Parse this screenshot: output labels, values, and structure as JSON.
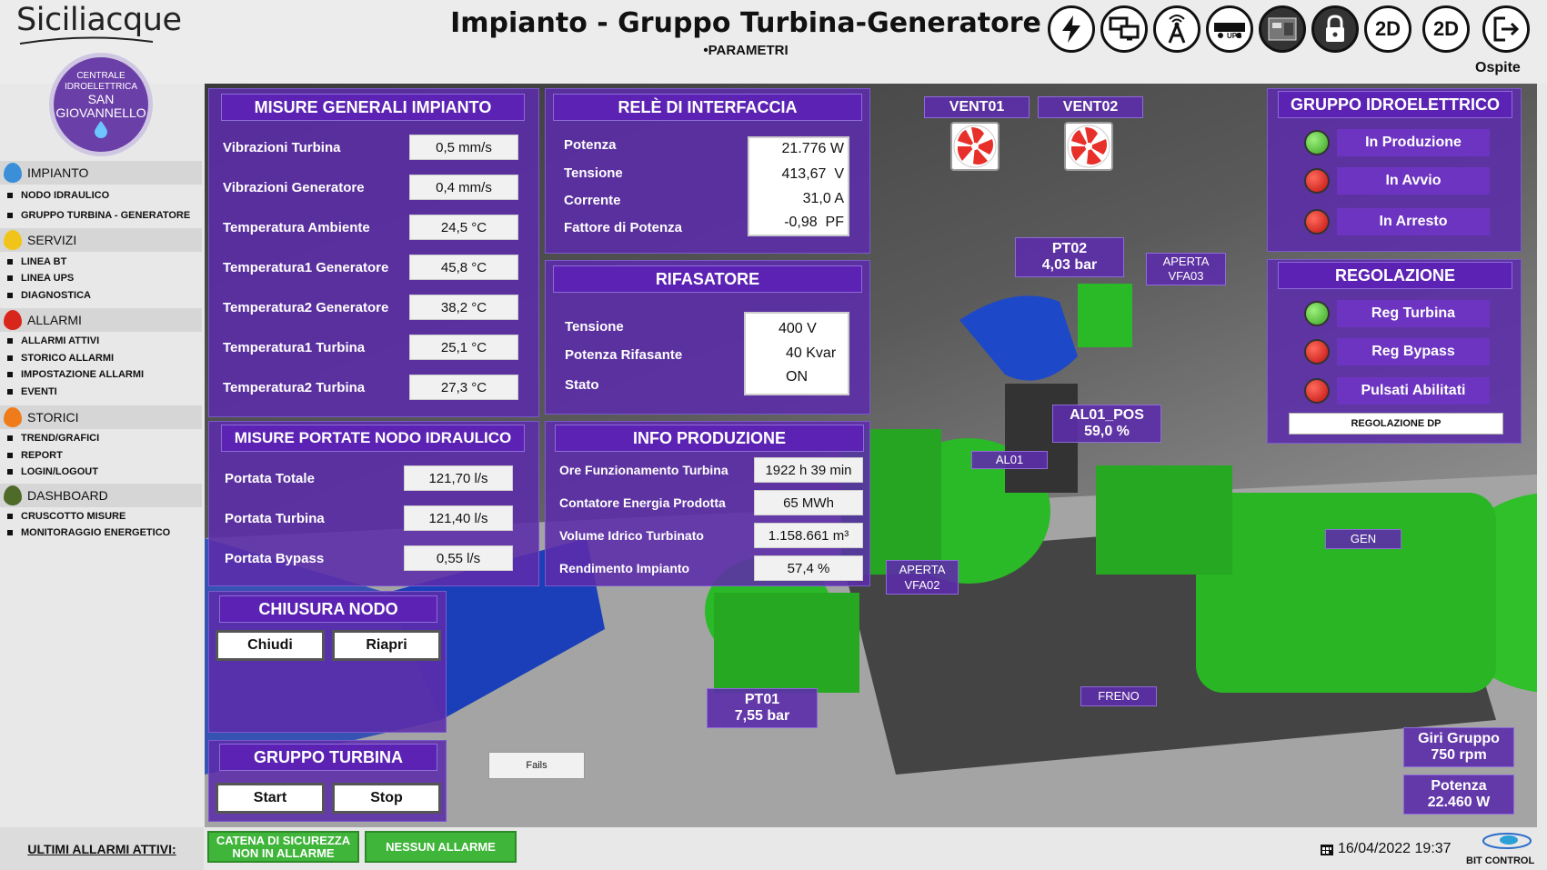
{
  "brand": "Siciliacque",
  "header": {
    "title": "Impianto - Gruppo Turbina-Generatore",
    "subtitle": "•PARAMETRI",
    "user": "Ospite"
  },
  "toolbar": {
    "btn_2d_a": "2D",
    "btn_2d_b": "2D",
    "ups_label": "UPS"
  },
  "logo": {
    "line1": "CENTRALE",
    "line2": "IDROELETTRICA",
    "line3": "SAN",
    "line4": "GIOVANNELLO"
  },
  "sidebar": {
    "impianto": {
      "label": "IMPIANTO",
      "items": [
        "NODO IDRAULICO",
        "GRUPPO TURBINA - GENERATORE"
      ],
      "color": "#3a8fd8"
    },
    "servizi": {
      "label": "SERVIZI",
      "items": [
        "LINEA BT",
        "LINEA UPS",
        "DIAGNOSTICA"
      ],
      "color": "#f0c419"
    },
    "allarmi": {
      "label": "ALLARMI",
      "items": [
        "ALLARMI ATTIVI",
        "STORICO ALLARMI",
        "IMPOSTAZIONE ALLARMI",
        "EVENTI"
      ],
      "color": "#d9261c"
    },
    "storici": {
      "label": "STORICI",
      "items": [
        "TREND/GRAFICI",
        "REPORT",
        "LOGIN/LOGOUT"
      ],
      "color": "#f07b1a"
    },
    "dashboard": {
      "label": "DASHBOARD",
      "items": [
        "CRUSCOTTO MISURE",
        "MONITORAGGIO ENERGETICO"
      ],
      "color": "#4e6b2a"
    }
  },
  "misure": {
    "title": "MISURE GENERALI IMPIANTO",
    "rows": [
      {
        "label": "Vibrazioni Turbina",
        "value": "0,5 mm/s"
      },
      {
        "label": "Vibrazioni Generatore",
        "value": "0,4 mm/s"
      },
      {
        "label": "Temperatura Ambiente",
        "value": "24,5 °C"
      },
      {
        "label": "Temperatura1 Generatore",
        "value": "45,8 °C"
      },
      {
        "label": "Temperatura2 Generatore",
        "value": "38,2 °C"
      },
      {
        "label": "Temperatura1 Turbina",
        "value": "25,1 °C"
      },
      {
        "label": "Temperatura2 Turbina",
        "value": "27,3 °C"
      }
    ]
  },
  "rele": {
    "title": "RELÈ DI INTERFACCIA",
    "labels": [
      "Potenza",
      "Tensione",
      "Corrente",
      "Fattore di Potenza"
    ],
    "values": [
      "21.776 W",
      "413,67  V",
      "31,0 A",
      "-0,98  PF"
    ]
  },
  "rifasatore": {
    "title": "RIFASATORE",
    "labels": [
      "Tensione",
      "Potenza Rifasante",
      "Stato"
    ],
    "values": [
      "400 V",
      "40 Kvar",
      "ON"
    ]
  },
  "portate": {
    "title": "MISURE PORTATE NODO IDRAULICO",
    "rows": [
      {
        "label": "Portata Totale",
        "value": "121,70 l/s"
      },
      {
        "label": "Portata Turbina",
        "value": "121,40 l/s"
      },
      {
        "label": "Portata Bypass",
        "value": "0,55 l/s"
      }
    ]
  },
  "produzione": {
    "title": "INFO PRODUZIONE",
    "rows": [
      {
        "label": "Ore Funzionamento Turbina",
        "value": "1922 h 39 min"
      },
      {
        "label": "Contatore Energia Prodotta",
        "value": "65 MWh"
      },
      {
        "label": "Volume Idrico Turbinato",
        "value": "1.158.661 m³"
      },
      {
        "label": "Rendimento Impianto",
        "value": "57,4 %"
      }
    ]
  },
  "chiusura": {
    "title": "CHIUSURA NODO",
    "chiudi": "Chiudi",
    "riapri": "Riapri"
  },
  "gruppo_turbina": {
    "title": "GRUPPO TURBINA",
    "start": "Start",
    "stop": "Stop"
  },
  "gruppo_idro": {
    "title": "GRUPPO IDROELETTRICO",
    "states": [
      {
        "label": "In Produzione",
        "led": "green"
      },
      {
        "label": "In Avvio",
        "led": "red"
      },
      {
        "label": "In Arresto",
        "led": "red"
      }
    ]
  },
  "regolazione": {
    "title": "REGOLAZIONE",
    "states": [
      {
        "label": "Reg Turbina",
        "led": "green"
      },
      {
        "label": "Reg Bypass",
        "led": "red"
      },
      {
        "label": "Pulsati Abilitati",
        "led": "red"
      }
    ],
    "button": "REGOLAZIONE DP"
  },
  "scene": {
    "vent01": "VENT01",
    "vent02": "VENT02",
    "pt02_name": "PT02",
    "pt02_value": "4,03 bar",
    "vfa03_state": "APERTA",
    "vfa03_name": "VFA03",
    "al01pos_name": "AL01_POS",
    "al01pos_value": "59,0 %",
    "al01": "AL01",
    "gen": "GEN",
    "vfa02_state": "APERTA",
    "vfa02_name": "VFA02",
    "pt01_name": "PT01",
    "pt01_value": "7,55 bar",
    "freno": "FRENO",
    "fails": "Fails",
    "giri_label": "Giri Gruppo",
    "giri_value": "750 rpm",
    "potenza_label": "Potenza",
    "potenza_value": "22.460 W"
  },
  "footer": {
    "alarms_label": "ULTIMI ALLARMI ATTIVI:",
    "catena_line1": "CATENA DI SICUREZZA",
    "catena_line2": "NON IN ALLARME",
    "nessun": "NESSUN ALLARME",
    "datetime": "16/04/2022 19:37",
    "bit1": "BIT",
    "bit2": "CONTROL"
  }
}
